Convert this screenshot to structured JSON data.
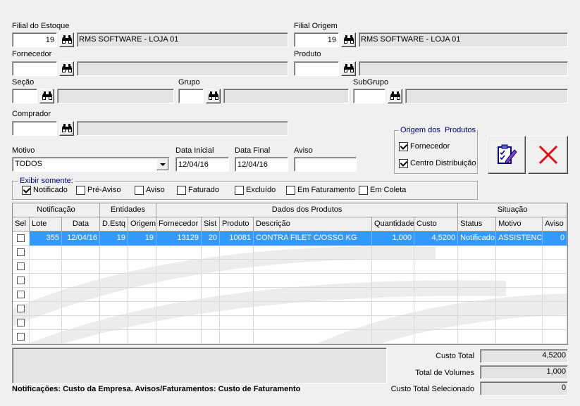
{
  "filters": {
    "filial_estoque": {
      "label": "Filial do Estoque",
      "code": "19",
      "name": "RMS SOFTWARE - LOJA 01"
    },
    "filial_origem": {
      "label": "Filial Origem",
      "code": "19",
      "name": "RMS SOFTWARE - LOJA 01"
    },
    "fornecedor": {
      "label": "Fornecedor",
      "code": "",
      "name": ""
    },
    "produto": {
      "label": "Produto",
      "code": "",
      "name": ""
    },
    "secao": {
      "label": "Seção",
      "code": "",
      "name": ""
    },
    "grupo": {
      "label": "Grupo",
      "code": "",
      "name": ""
    },
    "subgrupo": {
      "label": "SubGrupo",
      "code": "",
      "name": ""
    },
    "comprador": {
      "label": "Comprador",
      "code": "",
      "name": ""
    },
    "motivo": {
      "label": "Motivo",
      "value": "TODOS"
    },
    "data_inicial": {
      "label": "Data Inicial",
      "value": "12/04/16"
    },
    "data_final": {
      "label": "Data Final",
      "value": "12/04/16"
    },
    "aviso": {
      "label": "Aviso",
      "value": ""
    }
  },
  "origem_produtos": {
    "title": "Origem dos  Produtos",
    "options": [
      {
        "label": "Fornecedor",
        "checked": true
      },
      {
        "label": "Centro Distribuição",
        "checked": true
      }
    ]
  },
  "icons": {
    "lookup": "binoculars-icon",
    "confirm": "clipboard-check-icon",
    "cancel": "close-icon",
    "dropdown": "chevron-down-icon"
  },
  "exibir_somente": {
    "title": "Exibir somente:",
    "options": [
      {
        "label": "Notificado",
        "checked": true
      },
      {
        "label": "Pré-Aviso",
        "checked": false
      },
      {
        "label": "Aviso",
        "checked": false
      },
      {
        "label": "Faturado",
        "checked": false
      },
      {
        "label": "Excluído",
        "checked": false
      },
      {
        "label": "Em Faturamento",
        "checked": false
      },
      {
        "label": "Em Coleta",
        "checked": false
      }
    ]
  },
  "grid": {
    "groups": [
      "Notificação",
      "Entidades",
      "Dados dos Produtos",
      "Situação"
    ],
    "columns": [
      "Sel",
      "Lote",
      "Data",
      "D.Estq",
      "Origem",
      "Fornecedor",
      "Sist",
      "Produto",
      "Descrição",
      "Quantidade",
      "Custo",
      "Status",
      "Motivo",
      "Aviso"
    ],
    "rows": [
      {
        "selected": true,
        "sel": false,
        "cells": [
          "355",
          "12/04/16",
          "19",
          "19",
          "13129",
          "20",
          "10081",
          "CONTRA FILET C/OSSO KG",
          "1,000",
          "4,5200",
          "Notificado",
          "ASSISTENCI",
          "0"
        ]
      }
    ]
  },
  "footer": {
    "note": "Notificações: Custo da Empresa. Avisos/Faturamentos: Custo de Faturamento",
    "totals": [
      {
        "label": "Custo Total",
        "value": "4,5200"
      },
      {
        "label": "Total de Volumes",
        "value": "1,000"
      },
      {
        "label": "Custo Total Selecionado",
        "value": "0"
      }
    ]
  },
  "colors": {
    "window_bg": "#f0f0f0",
    "selection": "#3399ff",
    "group_title": "#000080",
    "cancel_red": "#e01010"
  }
}
